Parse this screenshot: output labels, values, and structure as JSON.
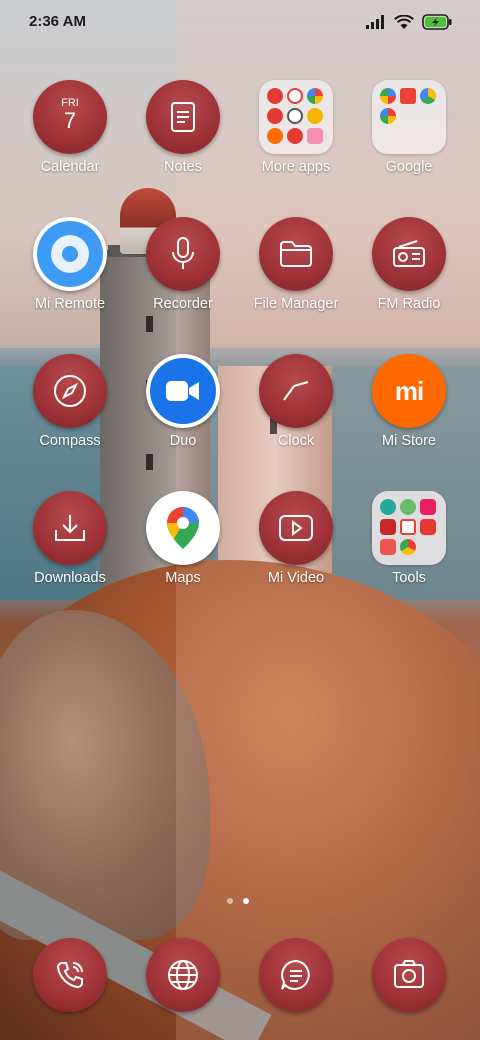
{
  "status_bar": {
    "time": "2:36 AM",
    "icons": [
      "signal-icon",
      "wifi-icon",
      "battery-charging-icon"
    ],
    "battery_color": "#49c23a"
  },
  "calendar": {
    "weekday": "FRI",
    "day": "7"
  },
  "apps": {
    "calendar": "Calendar",
    "notes": "Notes",
    "more_apps": "More apps",
    "google": "Google",
    "mi_remote": "Mi Remote",
    "recorder": "Recorder",
    "file_manager": "File Manager",
    "fm_radio": "FM Radio",
    "compass": "Compass",
    "duo": "Duo",
    "clock": "Clock",
    "mi_store": "Mi Store",
    "downloads": "Downloads",
    "maps": "Maps",
    "mi_video": "Mi Video",
    "tools": "Tools"
  },
  "mi_store_logo": "mi",
  "dock": [
    "phone-icon",
    "browser-globe-icon",
    "messaging-icon",
    "camera-icon"
  ],
  "page_indicator": {
    "pages": 2,
    "current": 2
  },
  "colors": {
    "icon_accent": "#9f3338",
    "mi_store": "#ff6900",
    "duo": "#1a73e8",
    "mi_remote": "#3d9bf3"
  }
}
